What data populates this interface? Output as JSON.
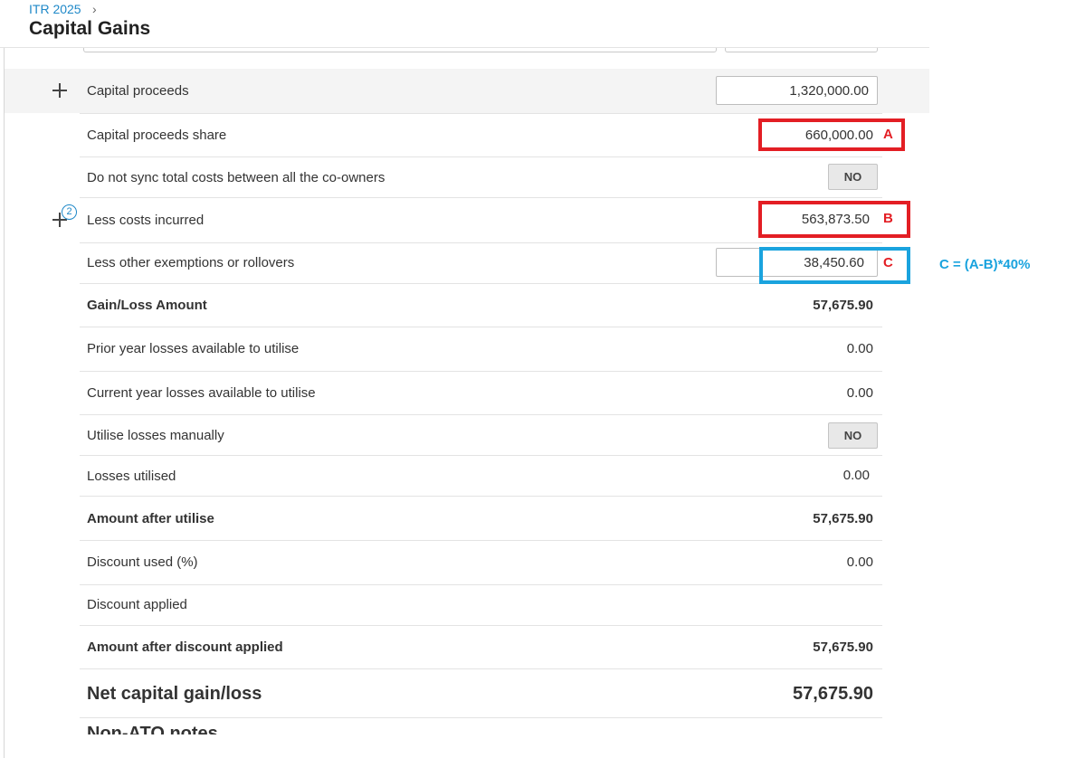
{
  "header": {
    "breadcrumb": "ITR 2025",
    "breadcrumb_separator": "›",
    "title": "Capital Gains"
  },
  "rows": {
    "capital_proceeds": {
      "label": "Capital proceeds",
      "value": "1,320,000.00"
    },
    "capital_proceeds_share": {
      "label": "Capital proceeds share",
      "value": "660,000.00"
    },
    "do_not_sync": {
      "label": "Do not sync total costs between all the co-owners",
      "value": "NO"
    },
    "less_costs_incurred": {
      "label": "Less costs incurred",
      "value": "563,873.50",
      "badge": "2"
    },
    "less_other_exemptions": {
      "label": "Less other exemptions or rollovers",
      "value": "38,450.60"
    },
    "gain_loss_amount": {
      "label": "Gain/Loss Amount",
      "value": "57,675.90"
    },
    "prior_year_losses": {
      "label": "Prior year losses available to utilise",
      "value": "0.00"
    },
    "current_year_losses": {
      "label": "Current year losses available to utilise",
      "value": "0.00"
    },
    "utilise_losses_manually": {
      "label": "Utilise losses manually",
      "value": "NO"
    },
    "losses_utilised": {
      "label": "Losses utilised",
      "value": "0.00"
    },
    "amount_after_utilise": {
      "label": "Amount after utilise",
      "value": "57,675.90"
    },
    "discount_used": {
      "label": "Discount used (%)",
      "value": "0.00"
    },
    "discount_applied": {
      "label": "Discount applied",
      "value": ""
    },
    "amount_after_discount": {
      "label": "Amount after discount applied",
      "value": "57,675.90"
    },
    "net_capital_gain": {
      "label": "Net capital gain/loss",
      "value": "57,675.90"
    },
    "non_ato_notes": {
      "label": "Non-ATO notes"
    }
  },
  "annotations": {
    "a": "A",
    "b": "B",
    "c": "C",
    "formula": "C = (A-B)*40%"
  },
  "colors": {
    "annotation_red": "#e31e24",
    "annotation_blue": "#1aa3de",
    "link_blue": "#1e88c8"
  }
}
